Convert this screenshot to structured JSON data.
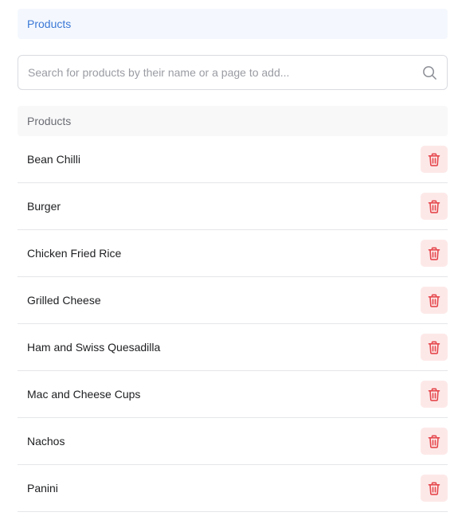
{
  "section": {
    "title": "Products"
  },
  "search": {
    "placeholder": "Search for products by their name or a page to add...",
    "value": "",
    "icon": "search-icon"
  },
  "table": {
    "header": "Products",
    "rows": [
      {
        "name": "Bean Chilli"
      },
      {
        "name": "Burger"
      },
      {
        "name": "Chicken Fried Rice"
      },
      {
        "name": "Grilled Cheese"
      },
      {
        "name": "Ham and Swiss Quesadilla"
      },
      {
        "name": "Mac and Cheese Cups"
      },
      {
        "name": "Nachos"
      },
      {
        "name": "Panini"
      }
    ],
    "delete_icon": "trash-icon"
  },
  "colors": {
    "accent": "#3b78d6",
    "danger": "#e5484d",
    "danger_bg": "#fde8e8"
  }
}
